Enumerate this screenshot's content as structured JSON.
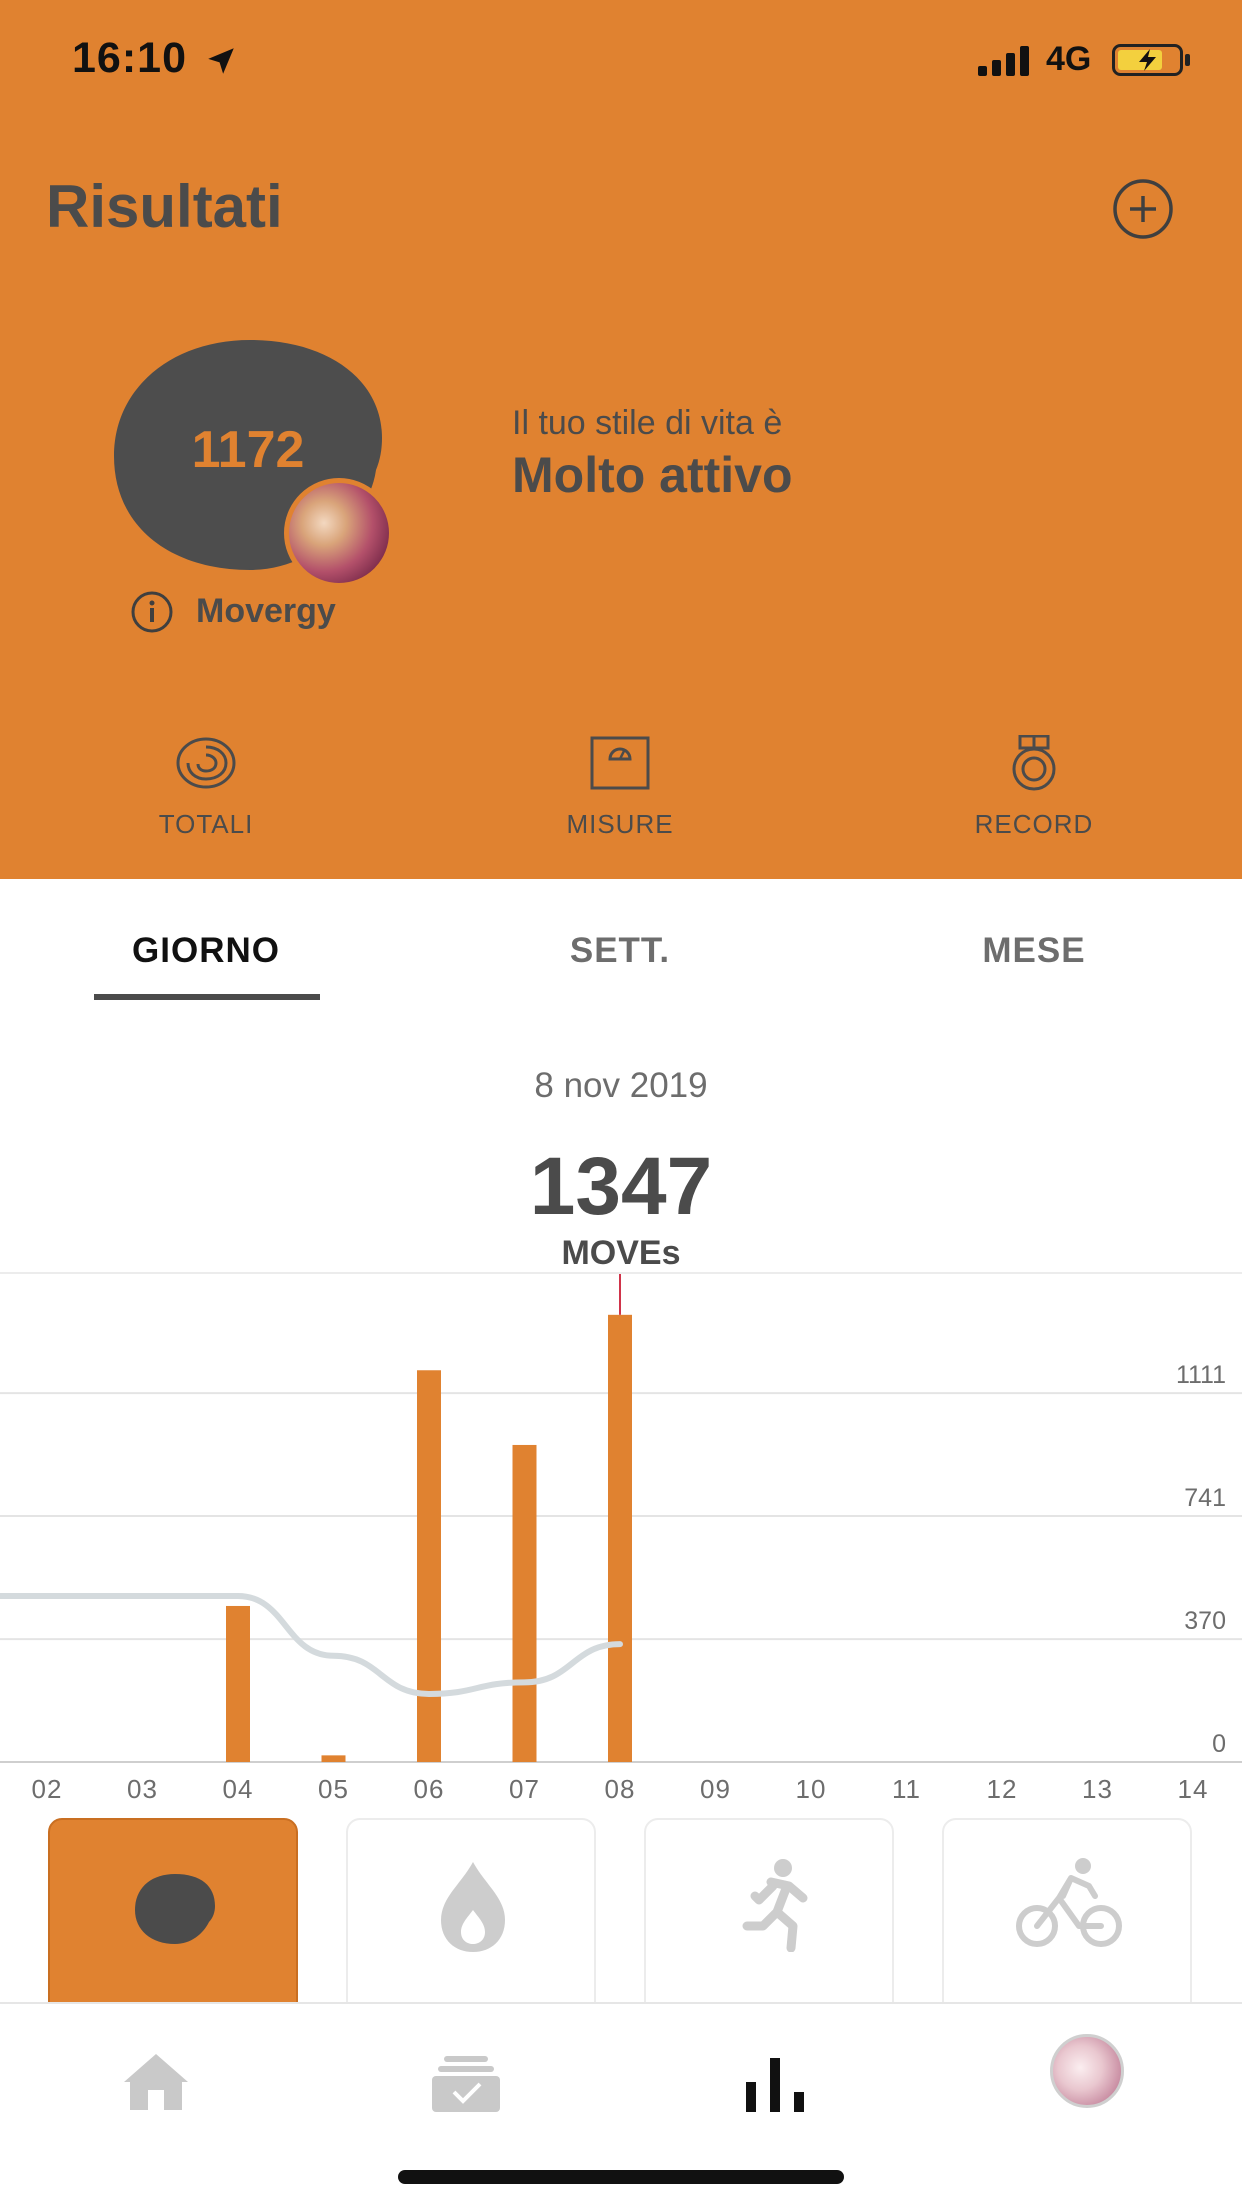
{
  "status_bar": {
    "time": "16:10",
    "network": "4G"
  },
  "header": {
    "title": "Risultati",
    "movergy_value": "1172",
    "movergy_label": "Movergy",
    "lifestyle_prefix": "Il tuo stile di vita è",
    "lifestyle_value": "Molto attivo",
    "accent_color": "#e08230"
  },
  "quick_links": [
    {
      "label": "TOTALI",
      "icon": "rings-icon"
    },
    {
      "label": "MISURE",
      "icon": "scale-icon"
    },
    {
      "label": "RECORD",
      "icon": "medal-icon"
    }
  ],
  "tabs": {
    "day": "GIORNO",
    "week": "SETT.",
    "month": "MESE",
    "active": "day"
  },
  "summary": {
    "date": "8 nov 2019",
    "value": "1347",
    "unit": "MOVEs"
  },
  "chart_data": {
    "type": "bar",
    "categories": [
      "02",
      "03",
      "04",
      "05",
      "06",
      "07",
      "08",
      "09",
      "10",
      "11",
      "12",
      "13",
      "14"
    ],
    "series": [
      {
        "values": [
          0,
          0,
          470,
          20,
          1180,
          955,
          1347,
          0,
          0,
          0,
          0,
          0,
          0
        ]
      },
      {
        "type": "line",
        "values": [
          500,
          500,
          500,
          320,
          205,
          240,
          355,
          null,
          null,
          null,
          null,
          null,
          null
        ]
      }
    ],
    "y_ticks": [
      "0",
      "370",
      "741",
      "1111"
    ],
    "ylim": [
      0,
      1482
    ],
    "selected": "08",
    "grid": true,
    "bar_color": "#e08230",
    "line_color": "#d4dadd",
    "marker_color": "#d0344a"
  },
  "categories": [
    {
      "icon": "movergy-blob-icon",
      "active": true
    },
    {
      "icon": "flame-icon",
      "active": false
    },
    {
      "icon": "runner-icon",
      "active": false
    },
    {
      "icon": "cyclist-icon",
      "active": false
    }
  ],
  "tab_bar": [
    {
      "icon": "home-icon"
    },
    {
      "icon": "activities-icon"
    },
    {
      "icon": "results-icon"
    },
    {
      "icon": "profile-avatar"
    }
  ]
}
